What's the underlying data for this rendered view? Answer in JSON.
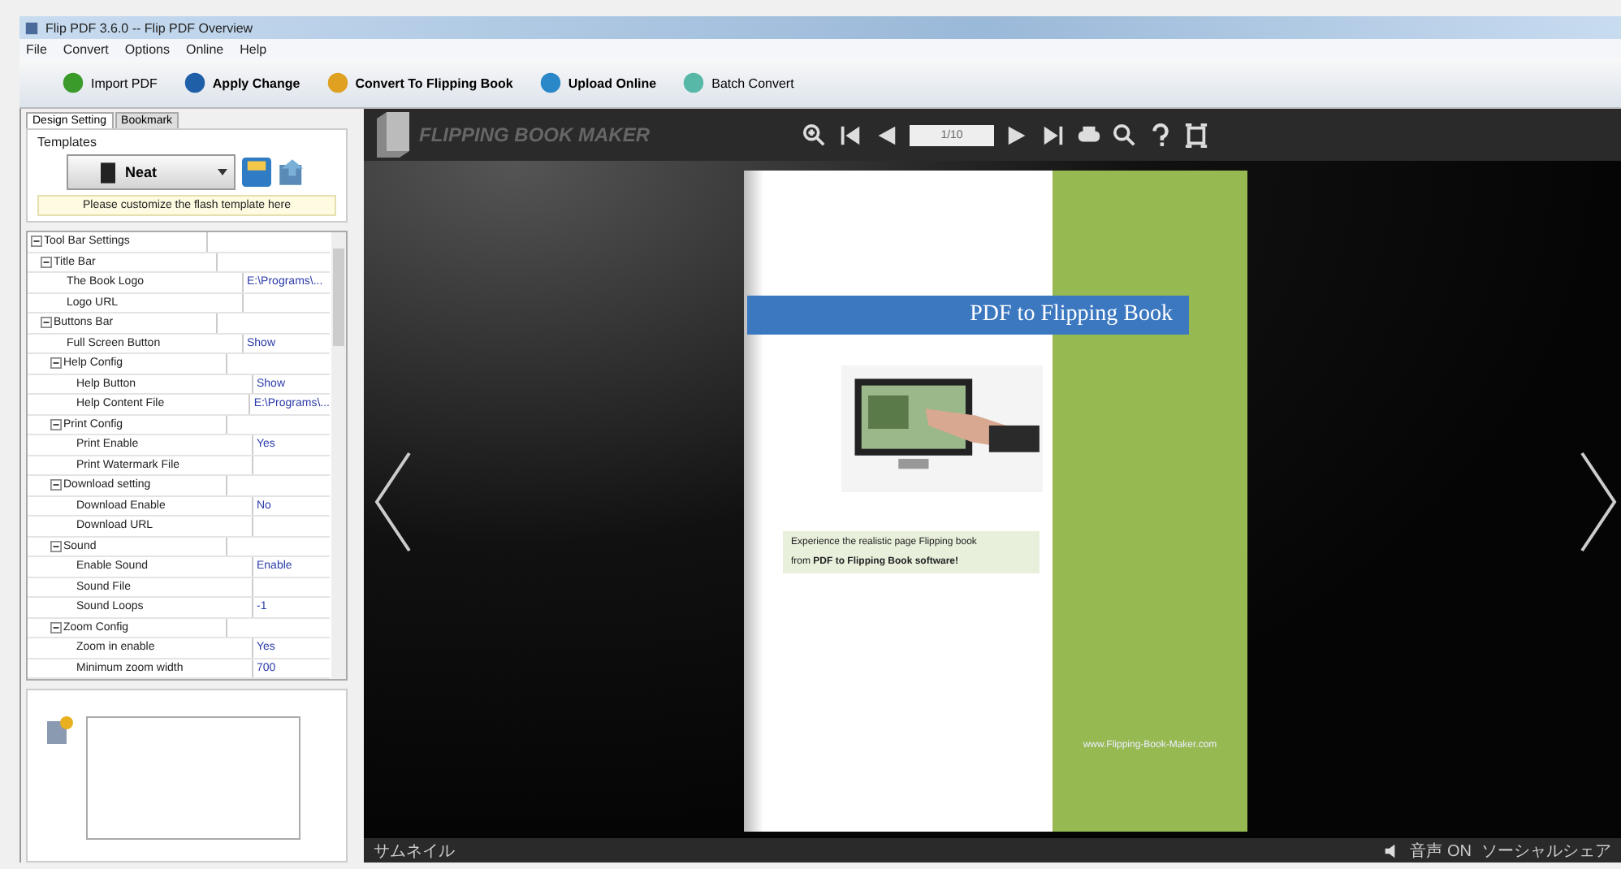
{
  "window": {
    "title": "Flip PDF 3.6.0 -- Flip PDF Overview"
  },
  "menu": [
    "File",
    "Convert",
    "Options",
    "Online",
    "Help"
  ],
  "toolbar": [
    {
      "label": "Import PDF",
      "bold": false
    },
    {
      "label": "Apply Change",
      "bold": true
    },
    {
      "label": "Convert To Flipping Book",
      "bold": true
    },
    {
      "label": "Upload Online",
      "bold": true
    },
    {
      "label": "Batch Convert",
      "bold": false
    }
  ],
  "panel": {
    "tabs": [
      {
        "label": "Design Setting",
        "selected": true
      },
      {
        "label": "Bookmark",
        "selected": false
      }
    ],
    "templates_label": "Templates",
    "template": "Neat",
    "hint": "Please customize the flash template here",
    "properties": [
      {
        "name": "Tool Bar Settings",
        "expanded": true,
        "children": [
          {
            "name": "Title Bar",
            "expanded": true,
            "children": [
              {
                "name": "The Book Logo",
                "value": "E:\\Programs\\..."
              },
              {
                "name": "Logo URL"
              }
            ]
          },
          {
            "name": "Buttons Bar",
            "expanded": true,
            "children": [
              {
                "name": "Full Screen Button",
                "value": "Show"
              },
              {
                "name": "Help Config",
                "expanded": true,
                "children": [
                  {
                    "name": "Help Button",
                    "value": "Show"
                  },
                  {
                    "name": "Help Content File",
                    "value": "E:\\Programs\\..."
                  }
                ]
              },
              {
                "name": "Print Config",
                "expanded": true,
                "children": [
                  {
                    "name": "Print Enable",
                    "value": "Yes"
                  },
                  {
                    "name": "Print Watermark File"
                  }
                ]
              },
              {
                "name": "Download setting",
                "expanded": true,
                "children": [
                  {
                    "name": "Download Enable",
                    "value": "No"
                  },
                  {
                    "name": "Download URL"
                  }
                ]
              },
              {
                "name": "Sound",
                "expanded": true,
                "children": [
                  {
                    "name": "Enable Sound",
                    "value": "Enable"
                  },
                  {
                    "name": "Sound File"
                  },
                  {
                    "name": "Sound Loops",
                    "value": "-1"
                  }
                ]
              },
              {
                "name": "Zoom Config",
                "expanded": true,
                "children": [
                  {
                    "name": "Zoom in enable",
                    "value": "Yes"
                  },
                  {
                    "name": "Minimum zoom width",
                    "value": "700"
                  }
                ]
              }
            ]
          }
        ]
      }
    ]
  },
  "viewer": {
    "brand": "FLIPPING BOOK MAKER",
    "page_field": "1/10",
    "book": {
      "title": "PDF to Flipping Book",
      "caption": [
        "Experience the realistic page Flipping book",
        "from **PDF to Flipping Book software!**"
      ],
      "website": "www.Flipping-Book-Maker.com"
    },
    "bottom_left": "サムネイル",
    "sound": "音声 ON",
    "share": "ソーシャルシェア"
  }
}
